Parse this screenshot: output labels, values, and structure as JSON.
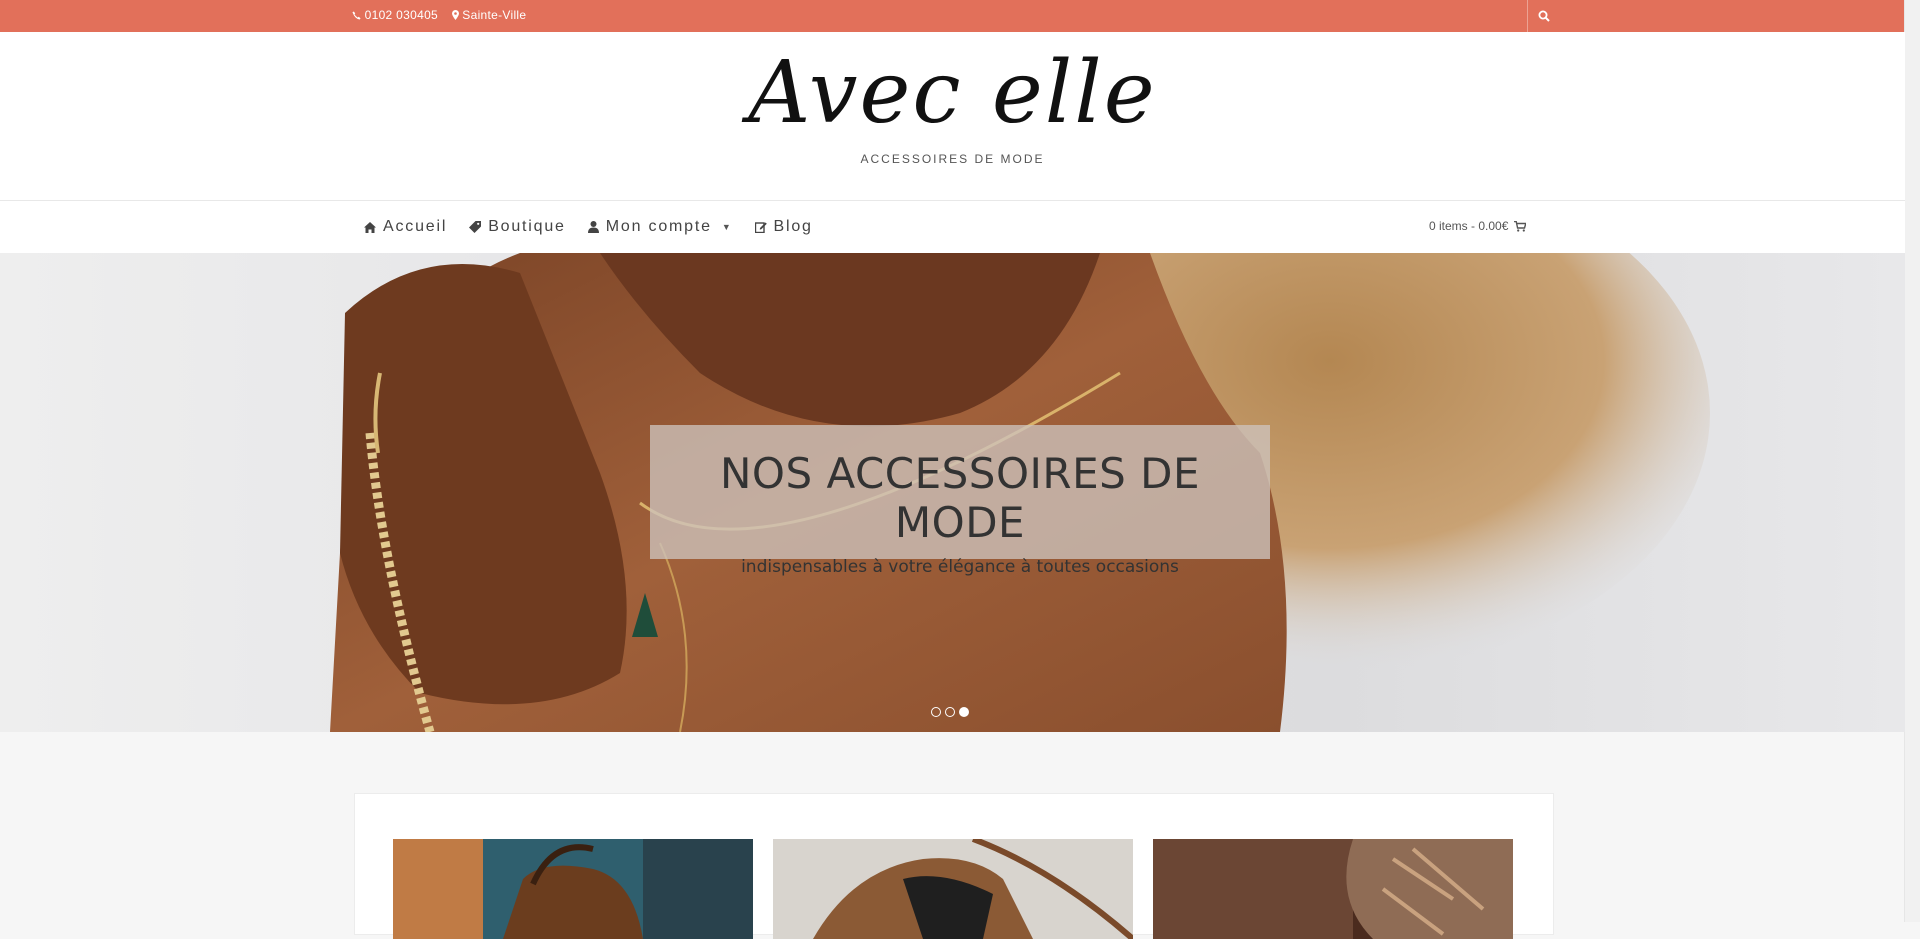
{
  "topbar": {
    "phone": "0102 030405",
    "location": "Sainte-Ville",
    "icons": {
      "phone": "phone-icon",
      "location": "map-marker-icon",
      "search": "search-icon"
    },
    "color": "#e2705a"
  },
  "header": {
    "logo": "Avec elle",
    "tagline": "ACCESSOIRES DE MODE"
  },
  "nav": {
    "items": [
      {
        "label": "Accueil",
        "icon": "home-icon"
      },
      {
        "label": "Boutique",
        "icon": "tag-icon"
      },
      {
        "label": "Mon compte",
        "icon": "user-icon",
        "has_dropdown": true
      },
      {
        "label": "Blog",
        "icon": "edit-icon"
      }
    ],
    "cart": "0 items - 0.00€",
    "cart_icon": "cart-icon"
  },
  "hero": {
    "headline": "NOS ACCESSOIRES DE MODE",
    "subline": "indispensables à votre élégance à toutes occasions",
    "slides": 3,
    "active_slide": 3
  },
  "products": {
    "cards": [
      {
        "image": "brown-leather-handbag"
      },
      {
        "image": "leather-bag-with-strap"
      },
      {
        "image": "brown-purse-and-scarf"
      }
    ]
  }
}
